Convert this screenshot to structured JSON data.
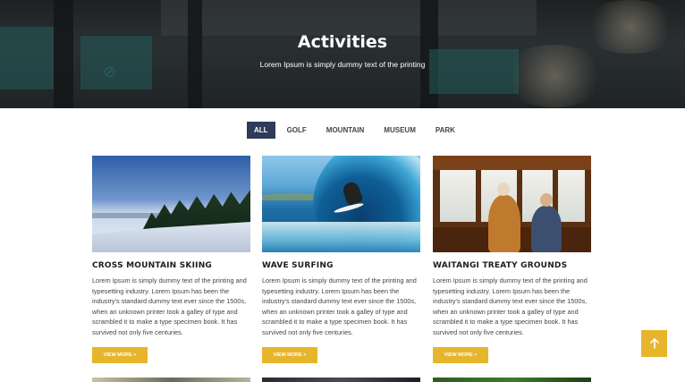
{
  "hero": {
    "title": "Activities",
    "subtitle": "Lorem Ipsum is simply dummy text of the printing"
  },
  "filters": [
    {
      "label": "ALL",
      "active": true
    },
    {
      "label": "GOLF",
      "active": false
    },
    {
      "label": "MOUNTAIN",
      "active": false
    },
    {
      "label": "MUSEUM",
      "active": false
    },
    {
      "label": "PARK",
      "active": false
    }
  ],
  "cards": [
    {
      "title": "CROSS MOUNTAIN SKIING",
      "description": "Lorem Ipsum is simply dummy text of the printing and typesetting industry. Lorem Ipsum has been the industry's standard dummy text ever since the 1500s, when an unknown printer took a galley of type and scrambled it to make a type specimen book. It has survived not only five centuries.",
      "button": "VIEW MORE +"
    },
    {
      "title": "WAVE SURFING",
      "description": "Lorem Ipsum is simply dummy text of the printing and typesetting industry. Lorem Ipsum has been the industry's standard dummy text ever since the 1500s, when an unknown printer took a galley of type and scrambled it to make a type specimen book. It has survived not only five centuries.",
      "button": "VIEW MORE +"
    },
    {
      "title": "WAITANGI TREATY GROUNDS",
      "description": "Lorem Ipsum is simply dummy text of the printing and typesetting industry. Lorem Ipsum has been the industry's standard dummy text ever since the 1500s, when an unknown printer took a galley of type and scrambled it to make a type specimen book. It has survived not only five centuries.",
      "button": "VIEW MORE +"
    }
  ],
  "colors": {
    "accent": "#e6b52c",
    "active_tab": "#2f3b58"
  },
  "icons": {
    "back_to_top": "arrow-up-icon"
  }
}
